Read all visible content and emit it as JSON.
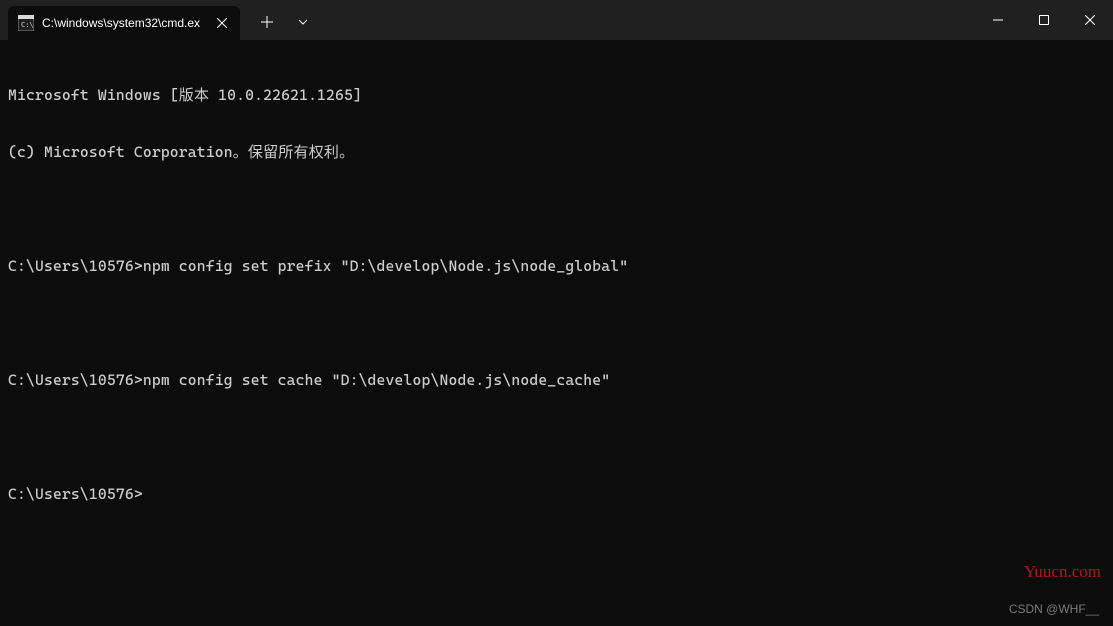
{
  "titlebar": {
    "tab": {
      "title": "C:\\windows\\system32\\cmd.ex",
      "icon_name": "cmd-icon"
    },
    "new_tab_label": "+",
    "dropdown_label": "v"
  },
  "terminal": {
    "lines": [
      "Microsoft Windows [版本 10.0.22621.1265]",
      "(c) Microsoft Corporation。保留所有权利。",
      "",
      "C:\\Users\\10576>npm config set prefix \"D:\\develop\\Node.js\\node_global\"",
      "",
      "C:\\Users\\10576>npm config set cache \"D:\\develop\\Node.js\\node_cache\"",
      "",
      "C:\\Users\\10576>"
    ]
  },
  "watermark": {
    "main": "Yuucn.com",
    "sub": "CSDN @WHF__"
  }
}
